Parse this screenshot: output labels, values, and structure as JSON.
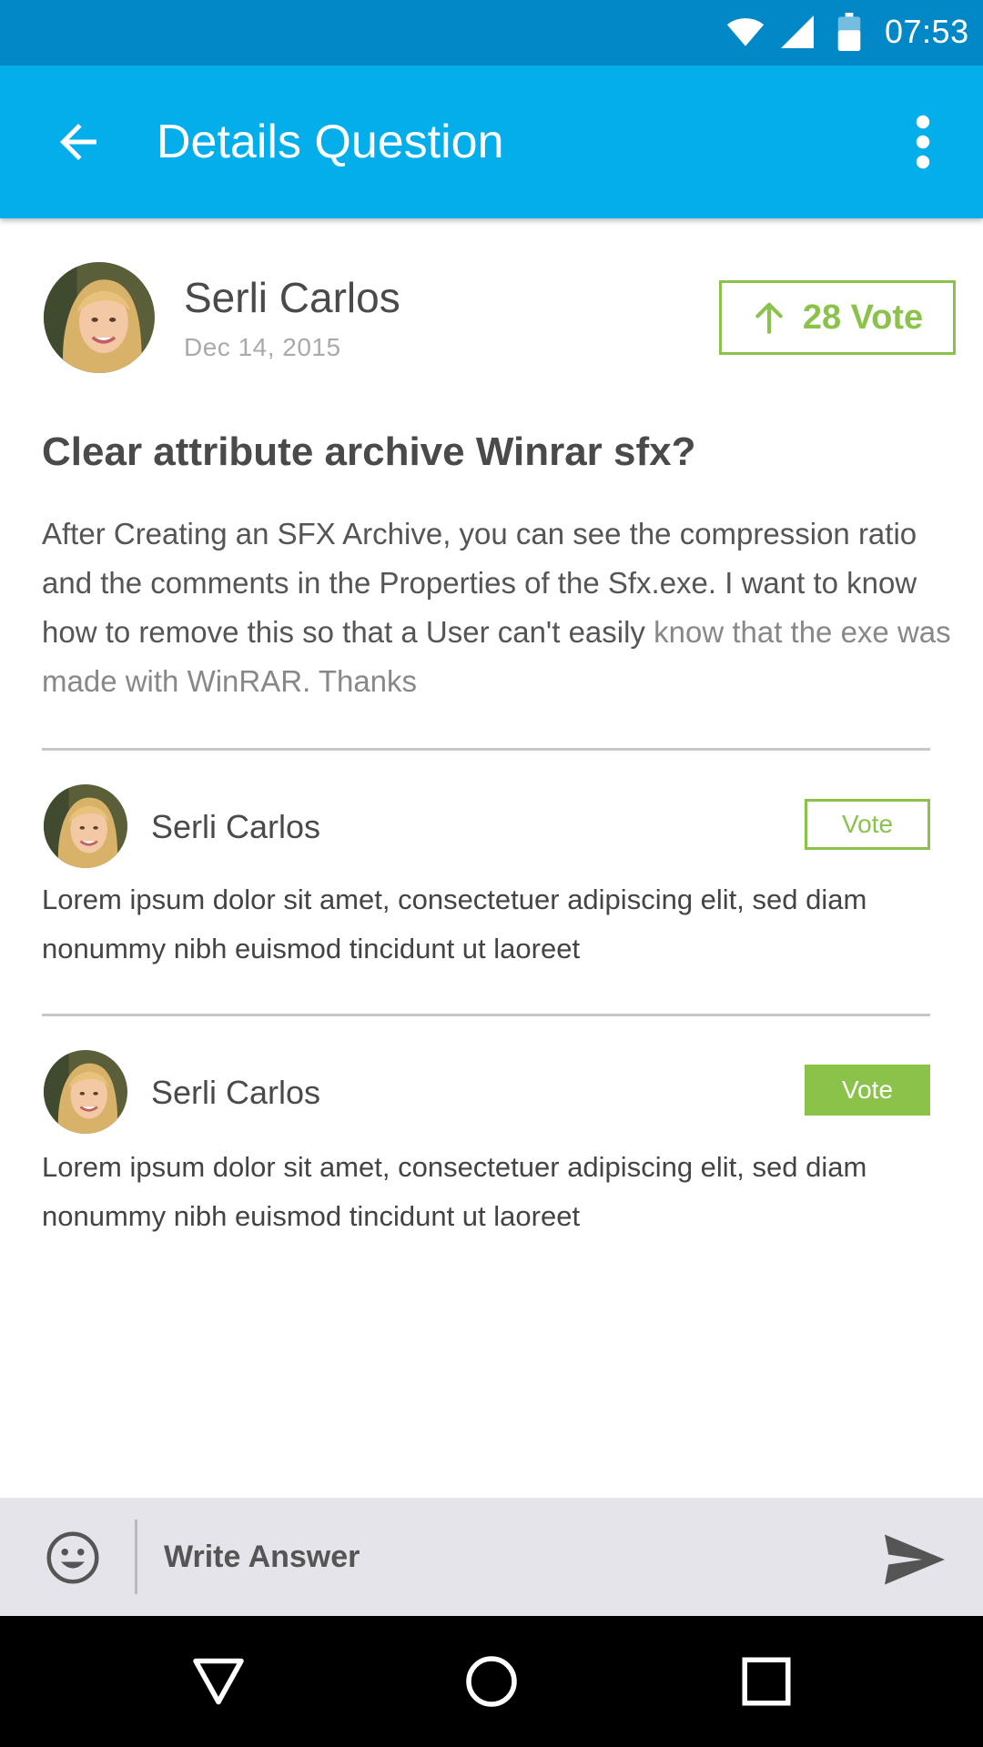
{
  "status_bar": {
    "time": "07:53",
    "icons": [
      "wifi-icon",
      "cell-signal-icon",
      "battery-icon"
    ]
  },
  "app_bar": {
    "title": "Details Question",
    "back_icon": "arrow-left-icon",
    "menu_icon": "more-vertical-icon",
    "background": "#03aeeb",
    "status_background": "#0288c6"
  },
  "question": {
    "author": "Serli Carlos",
    "date": "Dec 14, 2015",
    "vote_label": "28 Vote",
    "vote_icon": "arrow-up-icon",
    "title": "Clear attribute archive Winrar sfx?",
    "body": "After Creating an SFX Archive, you can see the compression ratio and the comments in the Properties of the Sfx.exe. I want to know how to remove this so that a User can't easily",
    "body_faded": "know that the exe was made with WinRAR. Thanks"
  },
  "answers": [
    {
      "author": "Serli Carlos",
      "vote_label": "Vote",
      "vote_state": "outline",
      "text": "Lorem ipsum dolor sit amet, consectetuer adipiscing elit, sed diam nonummy nibh euismod tincidunt ut laoreet"
    },
    {
      "author": "Serli Carlos",
      "vote_label": "Vote",
      "vote_state": "filled",
      "text": "Lorem ipsum dolor sit amet, consectetuer adipiscing elit, sed diam nonummy nibh euismod tincidunt ut laoreet"
    }
  ],
  "answer_bar": {
    "placeholder": "Write Answer",
    "value": "",
    "emoji_icon": "smiley-icon",
    "send_icon": "send-icon"
  },
  "nav_bar": {
    "icons": [
      "nav-back-icon",
      "nav-home-icon",
      "nav-recents-icon"
    ]
  },
  "colors": {
    "accent_green": "#8bc34a",
    "text_dark": "#4a4a4a",
    "input_bar": "#e4e4ea"
  }
}
